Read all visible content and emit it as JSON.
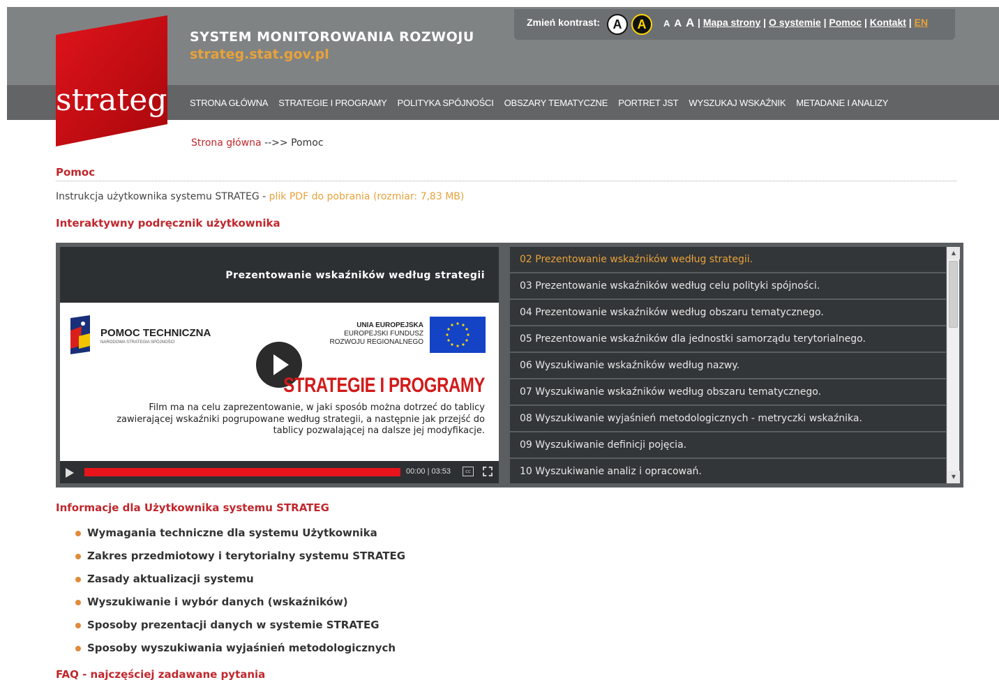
{
  "header": {
    "site_title": "SYSTEM MONITOROWANIA ROZWOJU",
    "site_url": "strateg.stat.gov.pl",
    "logo_text": "strateg",
    "colors": {
      "brand_red": "#c0272d",
      "accent_orange": "#e8a23a",
      "header_gray": "#808384",
      "nav_gray": "#626466"
    }
  },
  "utility": {
    "contrast_label": "Zmień kontrast:",
    "contrast_normal": "A",
    "contrast_high": "A",
    "font_sizes": [
      "A",
      "A",
      "A"
    ],
    "links": [
      "Mapa strony",
      "O systemie",
      "Pomoc",
      "Kontakt"
    ],
    "lang": "EN"
  },
  "nav": {
    "items": [
      "STRONA GŁÓWNA",
      "STRATEGIE I PROGRAMY",
      "POLITYKA SPÓJNOŚCI",
      "OBSZARY TEMATYCZNE",
      "PORTRET JST",
      "WYSZUKAJ WSKAŹNIK",
      "METADANE I ANALIZY"
    ]
  },
  "breadcrumb": {
    "home": "Strona główna",
    "separator": "-->>",
    "current": "Pomoc"
  },
  "page": {
    "title": "Pomoc",
    "manual_text": "Instrukcja użytkownika systemu STRATEG - ",
    "manual_link": "plik PDF do pobrania (rozmiar: 7,83 MB)",
    "interactive_heading": "Interaktywny podręcznik użytkownika"
  },
  "video": {
    "title": "Prezentowanie wskaźników według strategii",
    "pt_title": "POMOC TECHNICZNA",
    "pt_sub": "NARODOWA STRATEGIA SPÓJNOŚCI",
    "ue_line1": "UNIA EUROPEJSKA",
    "ue_line2": "EUROPEJSKI FUNDUSZ",
    "ue_line3": "ROZWOJU REGIONALNEGO",
    "headline": "STRATEGIE I PROGRAMY",
    "description": "Film ma na celu zaprezentowanie, w jaki sposób można dotrzeć do tablicy zawierającej wskaźniki pogrupowane według strategii, a następnie jak przejść do tablicy pozwalającej na dalsze jej modyfikacje.",
    "time": "00:00 | 03:53",
    "cc": "cc"
  },
  "playlist": {
    "items": [
      "02 Prezentowanie wskaźników według strategii.",
      "03 Prezentowanie wskaźników według celu polityki spójności.",
      "04 Prezentowanie wskaźników według obszaru tematycznego.",
      "05 Prezentowanie wskaźników dla jednostki samorządu terytorialnego.",
      "06 Wyszukiwanie wskaźników według nazwy.",
      "07 Wyszukiwanie wskaźników według obszaru tematycznego.",
      "08 Wyszukiwanie wyjaśnień metodologicznych - metryczki wskaźnika.",
      "09 Wyszukiwanie definicji pojęcia.",
      "10 Wyszukiwanie analiz i opracowań."
    ]
  },
  "info": {
    "heading": "Informacje dla Użytkownika systemu STRATEG",
    "items": [
      "Wymagania techniczne dla systemu Użytkownika",
      "Zakres przedmiotowy i terytorialny systemu STRATEG",
      "Zasady aktualizacji systemu",
      "Wyszukiwanie i wybór danych (wskaźników)",
      "Sposoby prezentacji danych w systemie STRATEG",
      "Sposoby wyszukiwania wyjaśnień metodologicznych"
    ]
  },
  "faq": {
    "heading": "FAQ - najczęściej zadawane pytania"
  }
}
